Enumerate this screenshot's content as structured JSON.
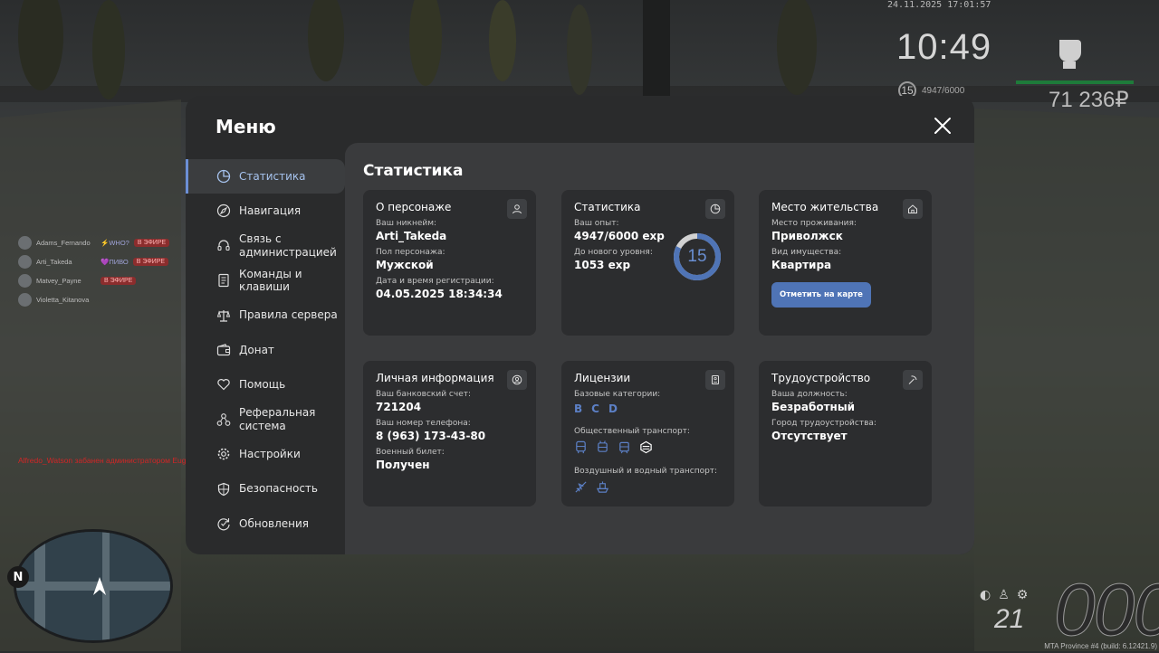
{
  "hud": {
    "datetime": "24.11.2025 17:01:57",
    "time": "10:49",
    "level": "15",
    "exp": "4947/6000",
    "money": "71 236₽",
    "build": "MTA Province #4 (build: 6.12421.9)",
    "speed": "21",
    "speed_big": "000"
  },
  "chat": [
    {
      "name": "Adams_Fernando",
      "tag": "⚡WHO?",
      "badge": "В ЭФИРЕ"
    },
    {
      "name": "Arti_Takeda",
      "tag": "💜ПИВО",
      "badge": "В ЭФИРЕ"
    },
    {
      "name": "Matvey_Payne",
      "tag": "",
      "badge": "В ЭФИРЕ"
    },
    {
      "name": "Violetta_Kitanova",
      "tag": "",
      "badge": ""
    }
  ],
  "ban_message": "Alfredo_Watson забанен администратором Eugenio_Fernando (Нарушение EMS)",
  "menu": {
    "title": "Меню",
    "items": [
      {
        "label": "Статистика",
        "icon": "chart-pie-icon"
      },
      {
        "label": "Навигация",
        "icon": "compass-icon"
      },
      {
        "label": "Связь с администрацией",
        "icon": "headset-icon"
      },
      {
        "label": "Команды и клавиши",
        "icon": "document-icon"
      },
      {
        "label": "Правила сервера",
        "icon": "scales-icon"
      },
      {
        "label": "Донат",
        "icon": "wallet-icon"
      },
      {
        "label": "Помощь",
        "icon": "heart-hand-icon"
      },
      {
        "label": "Реферальная система",
        "icon": "network-icon"
      },
      {
        "label": "Настройки",
        "icon": "gear-icon"
      },
      {
        "label": "Безопасность",
        "icon": "shield-icon"
      },
      {
        "label": "Обновления",
        "icon": "refresh-check-icon"
      }
    ]
  },
  "stats": {
    "title": "Статистика",
    "character": {
      "title": "О персонаже",
      "nick_label": "Ваш никнейм:",
      "nick": "Arti_Takeda",
      "gender_label": "Пол персонажа:",
      "gender": "Мужской",
      "reg_label": "Дата и время регистрации:",
      "reg": "04.05.2025 18:34:34"
    },
    "statistics": {
      "title": "Статистика",
      "exp_label": "Ваш опыт:",
      "exp": "4947/6000 exp",
      "next_label": "До нового уровня:",
      "next": "1053 exp",
      "level": "15",
      "progress": 0.8245
    },
    "residence": {
      "title": "Место жительства",
      "place_label": "Место проживания:",
      "place": "Приволжск",
      "type_label": "Вид имущества:",
      "type": "Квартира",
      "button": "Отметить на карте"
    },
    "personal": {
      "title": "Личная информация",
      "bank_label": "Ваш банковский счет:",
      "bank": "721204",
      "phone_label": "Ваш номер телефона:",
      "phone": "8 (963) 173-43-80",
      "military_label": "Военный билет:",
      "military": "Получен"
    },
    "licenses": {
      "title": "Лицензии",
      "base_label": "Базовые категории:",
      "categories": [
        "B",
        "C",
        "D"
      ],
      "public_label": "Общественный транспорт:",
      "air_label": "Воздушный и водный транспорт:"
    },
    "employment": {
      "title": "Трудоустройство",
      "position_label": "Ваша должность:",
      "position": "Безработный",
      "city_label": "Город трудоустройства:",
      "city": "Отсутствует"
    }
  },
  "colors": {
    "accent": "#5c80c6",
    "modal_bg": "#2a2b2c",
    "content_bg": "#3a3b3d",
    "card_bg": "#2c2d2f"
  }
}
